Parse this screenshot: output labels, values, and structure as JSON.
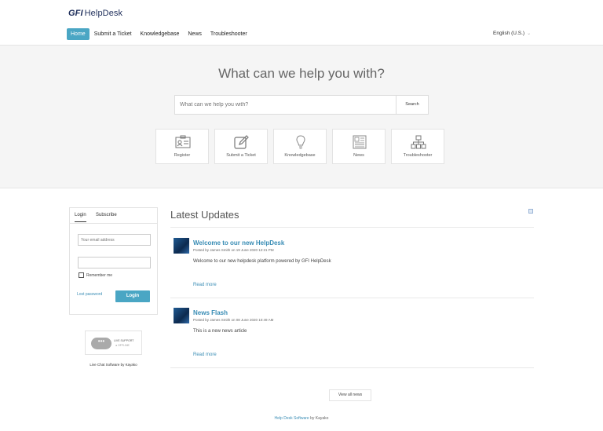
{
  "header": {
    "logo_prefix": "GFI",
    "logo_word": "HelpDesk",
    "nav": [
      {
        "label": "Home"
      },
      {
        "label": "Submit a Ticket"
      },
      {
        "label": "Knowledgebase"
      },
      {
        "label": "News"
      },
      {
        "label": "Troubleshooter"
      }
    ],
    "language": "English (U.S.)"
  },
  "hero": {
    "title": "What can we help you with?",
    "search_placeholder": "What can we help you with?",
    "search_button": "Search",
    "tiles": [
      {
        "label": "Register",
        "icon": "register-card-icon"
      },
      {
        "label": "Submit a Ticket",
        "icon": "edit-icon"
      },
      {
        "label": "Knowledgebase",
        "icon": "lightbulb-icon"
      },
      {
        "label": "News",
        "icon": "newspaper-icon"
      },
      {
        "label": "Troubleshooter",
        "icon": "sitemap-icon"
      }
    ]
  },
  "login": {
    "tab_login": "Login",
    "tab_subscribe": "Subscribe",
    "email_placeholder": "Your email address",
    "remember_me": "Remember me",
    "lost_password": "Lost password",
    "login_button": "Login"
  },
  "live_chat": {
    "badge_line1": "LIVE SUPPORT",
    "badge_line2": "● OFFLINE",
    "credit": "Live Chat Software by Kayako"
  },
  "updates": {
    "title": "Latest Updates",
    "items": [
      {
        "title": "Welcome to our new HelpDesk",
        "posted": "Posted by James Smith on 19 June 2020 12:21 PM",
        "body": "Welcome to our new helpdesk platform powered by GFI HelpDesk",
        "read_more": "Read more"
      },
      {
        "title": "News Flash",
        "posted": "Posted by James Smith on 08 June 2020 10:49 AM",
        "body": "This is a new news article",
        "read_more": "Read more"
      }
    ],
    "view_all": "View all news"
  },
  "footer": {
    "link": "Help Desk Software",
    "suffix": " by Kayako"
  }
}
